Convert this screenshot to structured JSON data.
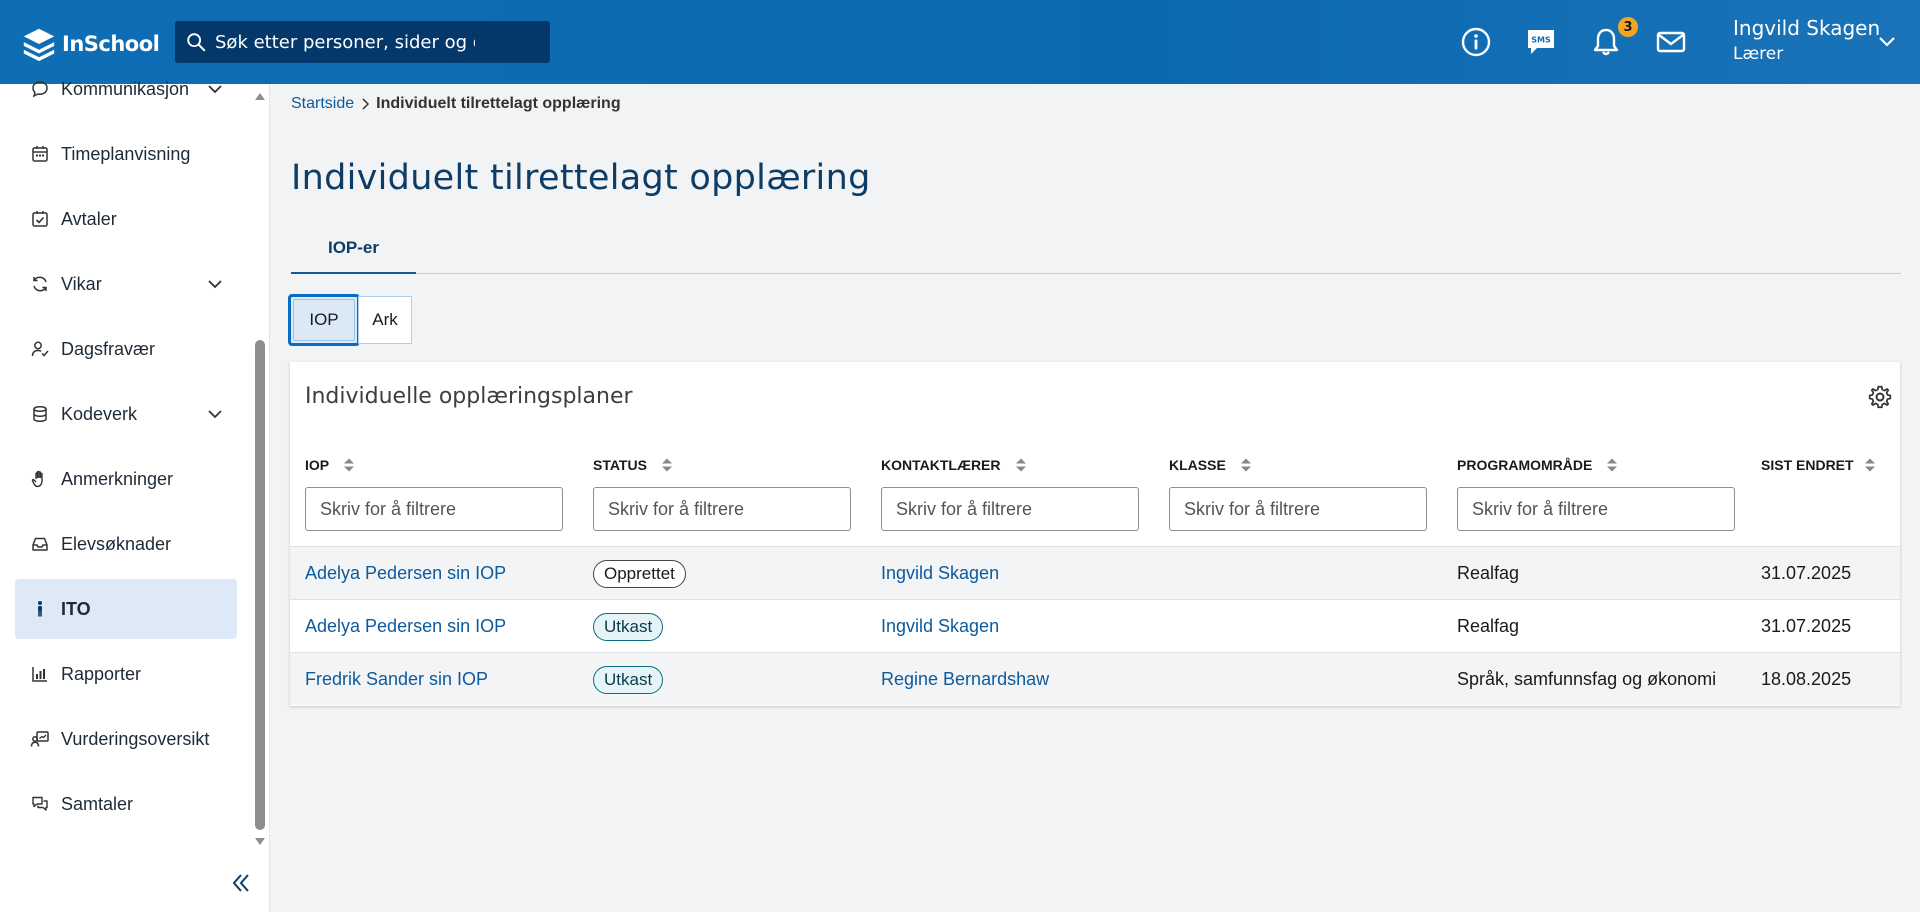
{
  "app": {
    "name": "InSchool"
  },
  "search": {
    "placeholder": "Søk etter personer, sider og grupper"
  },
  "header": {
    "notification_count": "3",
    "user_name": "Ingvild Skagen",
    "user_role": "Lærer"
  },
  "sidebar": {
    "items": [
      {
        "label": "Kommunikasjon",
        "icon": "chat-bubble-icon"
      },
      {
        "label": "Timeplanvisning",
        "icon": "calendar-icon"
      },
      {
        "label": "Avtaler",
        "icon": "calendar-check-icon"
      },
      {
        "label": "Vikar",
        "icon": "refresh-icon"
      },
      {
        "label": "Dagsfravær",
        "icon": "user-check-icon"
      },
      {
        "label": "Kodeverk",
        "icon": "database-icon"
      },
      {
        "label": "Anmerkninger",
        "icon": "hand-icon"
      },
      {
        "label": "Elevsøknader",
        "icon": "inbox-icon"
      },
      {
        "label": "ITO",
        "icon": "person-icon"
      },
      {
        "label": "Rapporter",
        "icon": "bar-chart-icon"
      },
      {
        "label": "Vurderingsoversikt",
        "icon": "assessment-icon"
      },
      {
        "label": "Samtaler",
        "icon": "conversation-icon"
      }
    ],
    "active": "ITO"
  },
  "breadcrumb": {
    "home": "Startside",
    "current": "Individuelt tilrettelagt opplæring"
  },
  "page": {
    "title": "Individuelt tilrettelagt opplæring",
    "tab": "IOP-er",
    "segments": {
      "iop": "IOP",
      "ark": "Ark"
    }
  },
  "table": {
    "title": "Individuelle opplæringsplaner",
    "columns": [
      "IOP",
      "STATUS",
      "KONTAKTLÆRER",
      "KLASSE",
      "PROGRAMOMRÅDE",
      "SIST ENDRET"
    ],
    "filter_placeholder": "Skriv for å filtrere",
    "rows": [
      {
        "iop": "Adelya Pedersen sin IOP",
        "status": "Opprettet",
        "kontaktlaerer": "Ingvild Skagen",
        "klasse": "",
        "programomrade": "Realfag",
        "sist_endret": "31.07.2025"
      },
      {
        "iop": "Adelya Pedersen sin IOP",
        "status": "Utkast",
        "kontaktlaerer": "Ingvild Skagen",
        "klasse": "",
        "programomrade": "Realfag",
        "sist_endret": "31.07.2025"
      },
      {
        "iop": "Fredrik Sander sin IOP",
        "status": "Utkast",
        "kontaktlaerer": "Regine Bernardshaw",
        "klasse": "",
        "programomrade": "Språk, samfunnsfag og økonomi",
        "sist_endret": "18.08.2025"
      }
    ]
  },
  "colors": {
    "header_blue": "#0f6db4",
    "link_blue": "#0d5a9c",
    "badge_orange": "#f5a524",
    "active_nav_bg": "#dde9f7"
  }
}
